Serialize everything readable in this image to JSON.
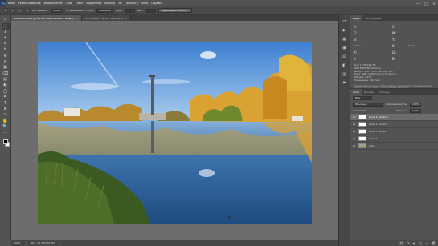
{
  "menubar": {
    "logo": "Ps",
    "items": [
      "Файл",
      "Редактирование",
      "Изображение",
      "Слои",
      "Текст",
      "Выделение",
      "Фильтр",
      "3D",
      "Просмотр",
      "Окно",
      "Справка"
    ],
    "window_controls": [
      "—",
      "□",
      "✕"
    ]
  },
  "options": {
    "feather_label": "Растушевка:",
    "feather_value": "0 пикс",
    "smoothing_label": "Сглаживание",
    "style_label": "Стиль:",
    "style_value": "Обычный",
    "width_label": "Шир.:",
    "height_label": "Выс.:",
    "select_mask_button": "Выделение и маска..."
  },
  "tabs": [
    {
      "label": "DSC00554.JPG @ 100% (Слой 1 копия 2, RGB/8)",
      "active": true
    },
    {
      "label": "Без имени-1 @ 66,7% (RGB/8)",
      "active": false
    }
  ],
  "toolbar": {
    "tools": [
      "⤧",
      "⬚",
      "ℓ",
      "⌖",
      "⌗",
      "✎",
      "⊕",
      "✐",
      "▣",
      "⌫",
      "▤",
      "◐",
      "◯",
      "✒",
      "T",
      "➤",
      "▭",
      "✋",
      "🔍",
      "⋯"
    ]
  },
  "status": {
    "zoom": "100%",
    "doc_info": "Док: 17,3M/102,7M",
    "arrow": "›"
  },
  "panelicons": [
    "⇄",
    "▶",
    "▦",
    "▣",
    "▤",
    "◧",
    "▥",
    "⚑"
  ],
  "info_panel": {
    "tabs": [
      "Инфо",
      "Гистограмма"
    ],
    "r_label": "R:",
    "g_label": "G:",
    "b_label": "B:",
    "c_label": "C:",
    "m_label": "M:",
    "y_label": "Y:",
    "k_label": "K:",
    "bits_left": "8-бит",
    "bits_right": "8-бит",
    "x_label": "X:",
    "y2_label": "Y:",
    "w_label": "Ш:",
    "h_label": "В:",
    "doc_lines": [
      "Док: 17,3M/102,7M",
      "4000 ВИЗМЭН 100 пикс.",
      "Выбор с HDR с 188 глаз (180 сел)",
      "Инфо: 6000 х 4000 пикс. (72 пикс/д)",
      "Рабочий: 2,37 Г",
      "Разрешение: 240 пикс"
    ],
    "hint": "Перемещайте мышь, чтобы увидеть выделение. Чтобы выделить область, используйте клавиши Shift, Alt и Ctrl."
  },
  "layers_panel": {
    "tabs": [
      "Слои",
      "Каналы",
      "Контуры"
    ],
    "kind_label": "Вид",
    "blend_mode": "Обычные",
    "opacity_label": "Непрозрачность:",
    "opacity_value": "100%",
    "lock_label": "Закрепить:",
    "fill_label": "Заливка:",
    "fill_value": "100%",
    "layers": [
      {
        "name": "Слой 1 копия 3",
        "selected": true,
        "photo": false
      },
      {
        "name": "Слой 1 копия 2",
        "selected": false,
        "photo": false
      },
      {
        "name": "Слой 1 копия",
        "selected": false,
        "photo": false
      },
      {
        "name": "Слой 1",
        "selected": false,
        "photo": false
      },
      {
        "name": "Фон",
        "selected": false,
        "photo": true
      }
    ],
    "footer_icons": [
      "⛓",
      "fx",
      "◐",
      "▢",
      "▭",
      "🗑"
    ]
  },
  "colors": {
    "app_bg": "#535353",
    "canvas_bg": "#6d6d6d",
    "selected_layer": "#6c6c6c",
    "sky_top": "#3e7fd0",
    "water": "#2e5f97",
    "foliage": "#d9a233"
  }
}
